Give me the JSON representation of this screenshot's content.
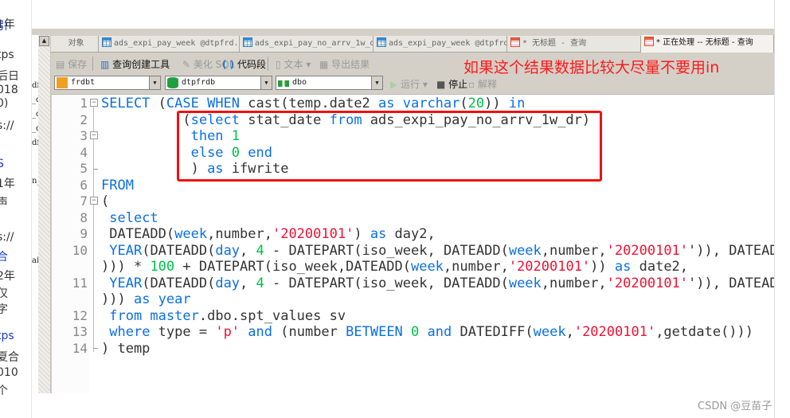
{
  "browser_fragments": [
    "1年",
    "引",
    "tps",
    "后日",
    "018",
    "0)",
    "s://",
    "S",
    "1年",
    "声",
    "s://",
    "合",
    "2年",
    "仅",
    "字",
    "tps",
    "夏合",
    "010",
    "个"
  ],
  "object_list_fragments": [
    "df",
    "_df",
    "_df",
    "_df_1",
    "df",
    "n_rfnd",
    "ail"
  ],
  "tabs": [
    {
      "label": "对象",
      "icon": "none"
    },
    {
      "label": "ads_expi_pay_week @dtpfrd...",
      "icon": "table-view-icon"
    },
    {
      "label": "ads_expi_pay_no_arrv_1w_d...",
      "icon": "table-icon"
    },
    {
      "label": "ads_expi_pay_week @dtpfrd...",
      "icon": "table-design-icon"
    },
    {
      "label": "* 无标题 - 查询",
      "icon": "query-icon"
    },
    {
      "label": "* 正在处理 -- 无标题 - 查询",
      "icon": "query-icon",
      "active": true
    }
  ],
  "toolbar": {
    "save": "保存",
    "query_builder": "查询创建工具",
    "beautify": "美化 SQL",
    "snippet": "代码段",
    "text": "文本",
    "export": "导出结果",
    "run": "运行",
    "stop": "停止",
    "explain": "解释"
  },
  "selectors": {
    "connection": "frdbt",
    "database": "dtpfrdb",
    "schema": "dbo"
  },
  "annotation": {
    "text": "如果这个结果数据比较大尽量不要用in",
    "color": "#ff1a1a"
  },
  "watermark": "CSDN @豆苗子",
  "code_colors": {
    "keyword": "#0b6fe6",
    "number": "#00c048",
    "string": "#ee1133",
    "plain": "#333333"
  },
  "code_lines": [
    {
      "n": "1",
      "fold": "box",
      "t": [
        [
          "k",
          "SELECT"
        ],
        [
          "p",
          " ("
        ],
        [
          "k",
          "CASE WHEN"
        ],
        [
          "p",
          " cast(temp.date2 "
        ],
        [
          "k",
          "as varchar"
        ],
        [
          "p",
          "("
        ],
        [
          "n",
          "20"
        ],
        [
          "p",
          ")) "
        ],
        [
          "k",
          "in"
        ]
      ]
    },
    {
      "n": "2",
      "t": [
        [
          "p",
          "          ("
        ],
        [
          "k",
          "select"
        ],
        [
          "p",
          " stat_date "
        ],
        [
          "k",
          "from"
        ],
        [
          "p",
          " ads_expi_pay_no_arrv_1w_dr)"
        ]
      ]
    },
    {
      "n": "3",
      "fold": "box",
      "t": [
        [
          "p",
          "           "
        ],
        [
          "k",
          "then"
        ],
        [
          "p",
          " "
        ],
        [
          "n",
          "1"
        ]
      ]
    },
    {
      "n": "4",
      "t": [
        [
          "p",
          "           "
        ],
        [
          "k",
          "else"
        ],
        [
          "p",
          " "
        ],
        [
          "n",
          "0"
        ],
        [
          "p",
          " "
        ],
        [
          "k",
          "end"
        ]
      ]
    },
    {
      "n": "5",
      "fold": "tick",
      "t": [
        [
          "p",
          "           ) "
        ],
        [
          "k",
          "as"
        ],
        [
          "p",
          " ifwrite"
        ]
      ]
    },
    {
      "n": "6",
      "t": [
        [
          "k",
          "FROM"
        ]
      ]
    },
    {
      "n": "7",
      "fold": "box",
      "t": [
        [
          "p",
          "("
        ]
      ]
    },
    {
      "n": "8",
      "t": [
        [
          "p",
          " "
        ],
        [
          "k",
          "select"
        ]
      ]
    },
    {
      "n": "9",
      "t": [
        [
          "p",
          " DATEADD("
        ],
        [
          "k",
          "week"
        ],
        [
          "p",
          ",number,"
        ],
        [
          "s",
          "'20200101'"
        ],
        [
          "p",
          ") "
        ],
        [
          "k",
          "as"
        ],
        [
          "p",
          " day2,"
        ]
      ]
    },
    {
      "n": "10",
      "t": [
        [
          "p",
          " "
        ],
        [
          "k",
          "YEAR"
        ],
        [
          "p",
          "(DATEADD("
        ],
        [
          "k",
          "day"
        ],
        [
          "p",
          ", "
        ],
        [
          "n",
          "4"
        ],
        [
          "p",
          " - DATEPART(iso_week, DATEADD("
        ],
        [
          "k",
          "week"
        ],
        [
          "p",
          ",number,"
        ],
        [
          "s",
          "'20200101'"
        ],
        [
          "p",
          "')), DATEADD"
        ]
      ]
    },
    {
      "n": "",
      "t": [
        [
          "p",
          ")))"
        ],
        [
          "p",
          " * "
        ],
        [
          "n",
          "100"
        ],
        [
          "p",
          " + DATEPART(iso_week,DATEADD("
        ],
        [
          "k",
          "week"
        ],
        [
          "p",
          ",number,"
        ],
        [
          "s",
          "'20200101'"
        ],
        [
          "p",
          ")) "
        ],
        [
          "k",
          "as"
        ],
        [
          "p",
          " date2,"
        ]
      ]
    },
    {
      "n": "11",
      "t": [
        [
          "p",
          " "
        ],
        [
          "k",
          "YEAR"
        ],
        [
          "p",
          "(DATEADD("
        ],
        [
          "k",
          "day"
        ],
        [
          "p",
          ", "
        ],
        [
          "n",
          "4"
        ],
        [
          "p",
          " - DATEPART(iso_week, DATEADD("
        ],
        [
          "k",
          "week"
        ],
        [
          "p",
          ",number,"
        ],
        [
          "s",
          "'20200101'"
        ],
        [
          "p",
          "')), DATEADD"
        ]
      ]
    },
    {
      "n": "",
      "t": [
        [
          "p",
          "))) "
        ],
        [
          "k",
          "as year"
        ]
      ]
    },
    {
      "n": "12",
      "t": [
        [
          "p",
          " "
        ],
        [
          "k",
          "from master"
        ],
        [
          "p",
          ".dbo.spt_values sv"
        ]
      ]
    },
    {
      "n": "13",
      "t": [
        [
          "p",
          " "
        ],
        [
          "k",
          "where"
        ],
        [
          "p",
          " type = "
        ],
        [
          "s",
          "'p'"
        ],
        [
          "p",
          " "
        ],
        [
          "k",
          "and"
        ],
        [
          "p",
          " (number "
        ],
        [
          "k",
          "BETWEEN"
        ],
        [
          "p",
          " "
        ],
        [
          "n",
          "0"
        ],
        [
          "p",
          " "
        ],
        [
          "k",
          "and"
        ],
        [
          "p",
          " DATEDIFF("
        ],
        [
          "k",
          "week"
        ],
        [
          "p",
          ","
        ],
        [
          "s",
          "'20200101'"
        ],
        [
          "p",
          ",getdate()))"
        ]
      ]
    },
    {
      "n": "14",
      "fold": "end",
      "t": [
        [
          "p",
          ") temp"
        ]
      ]
    }
  ]
}
